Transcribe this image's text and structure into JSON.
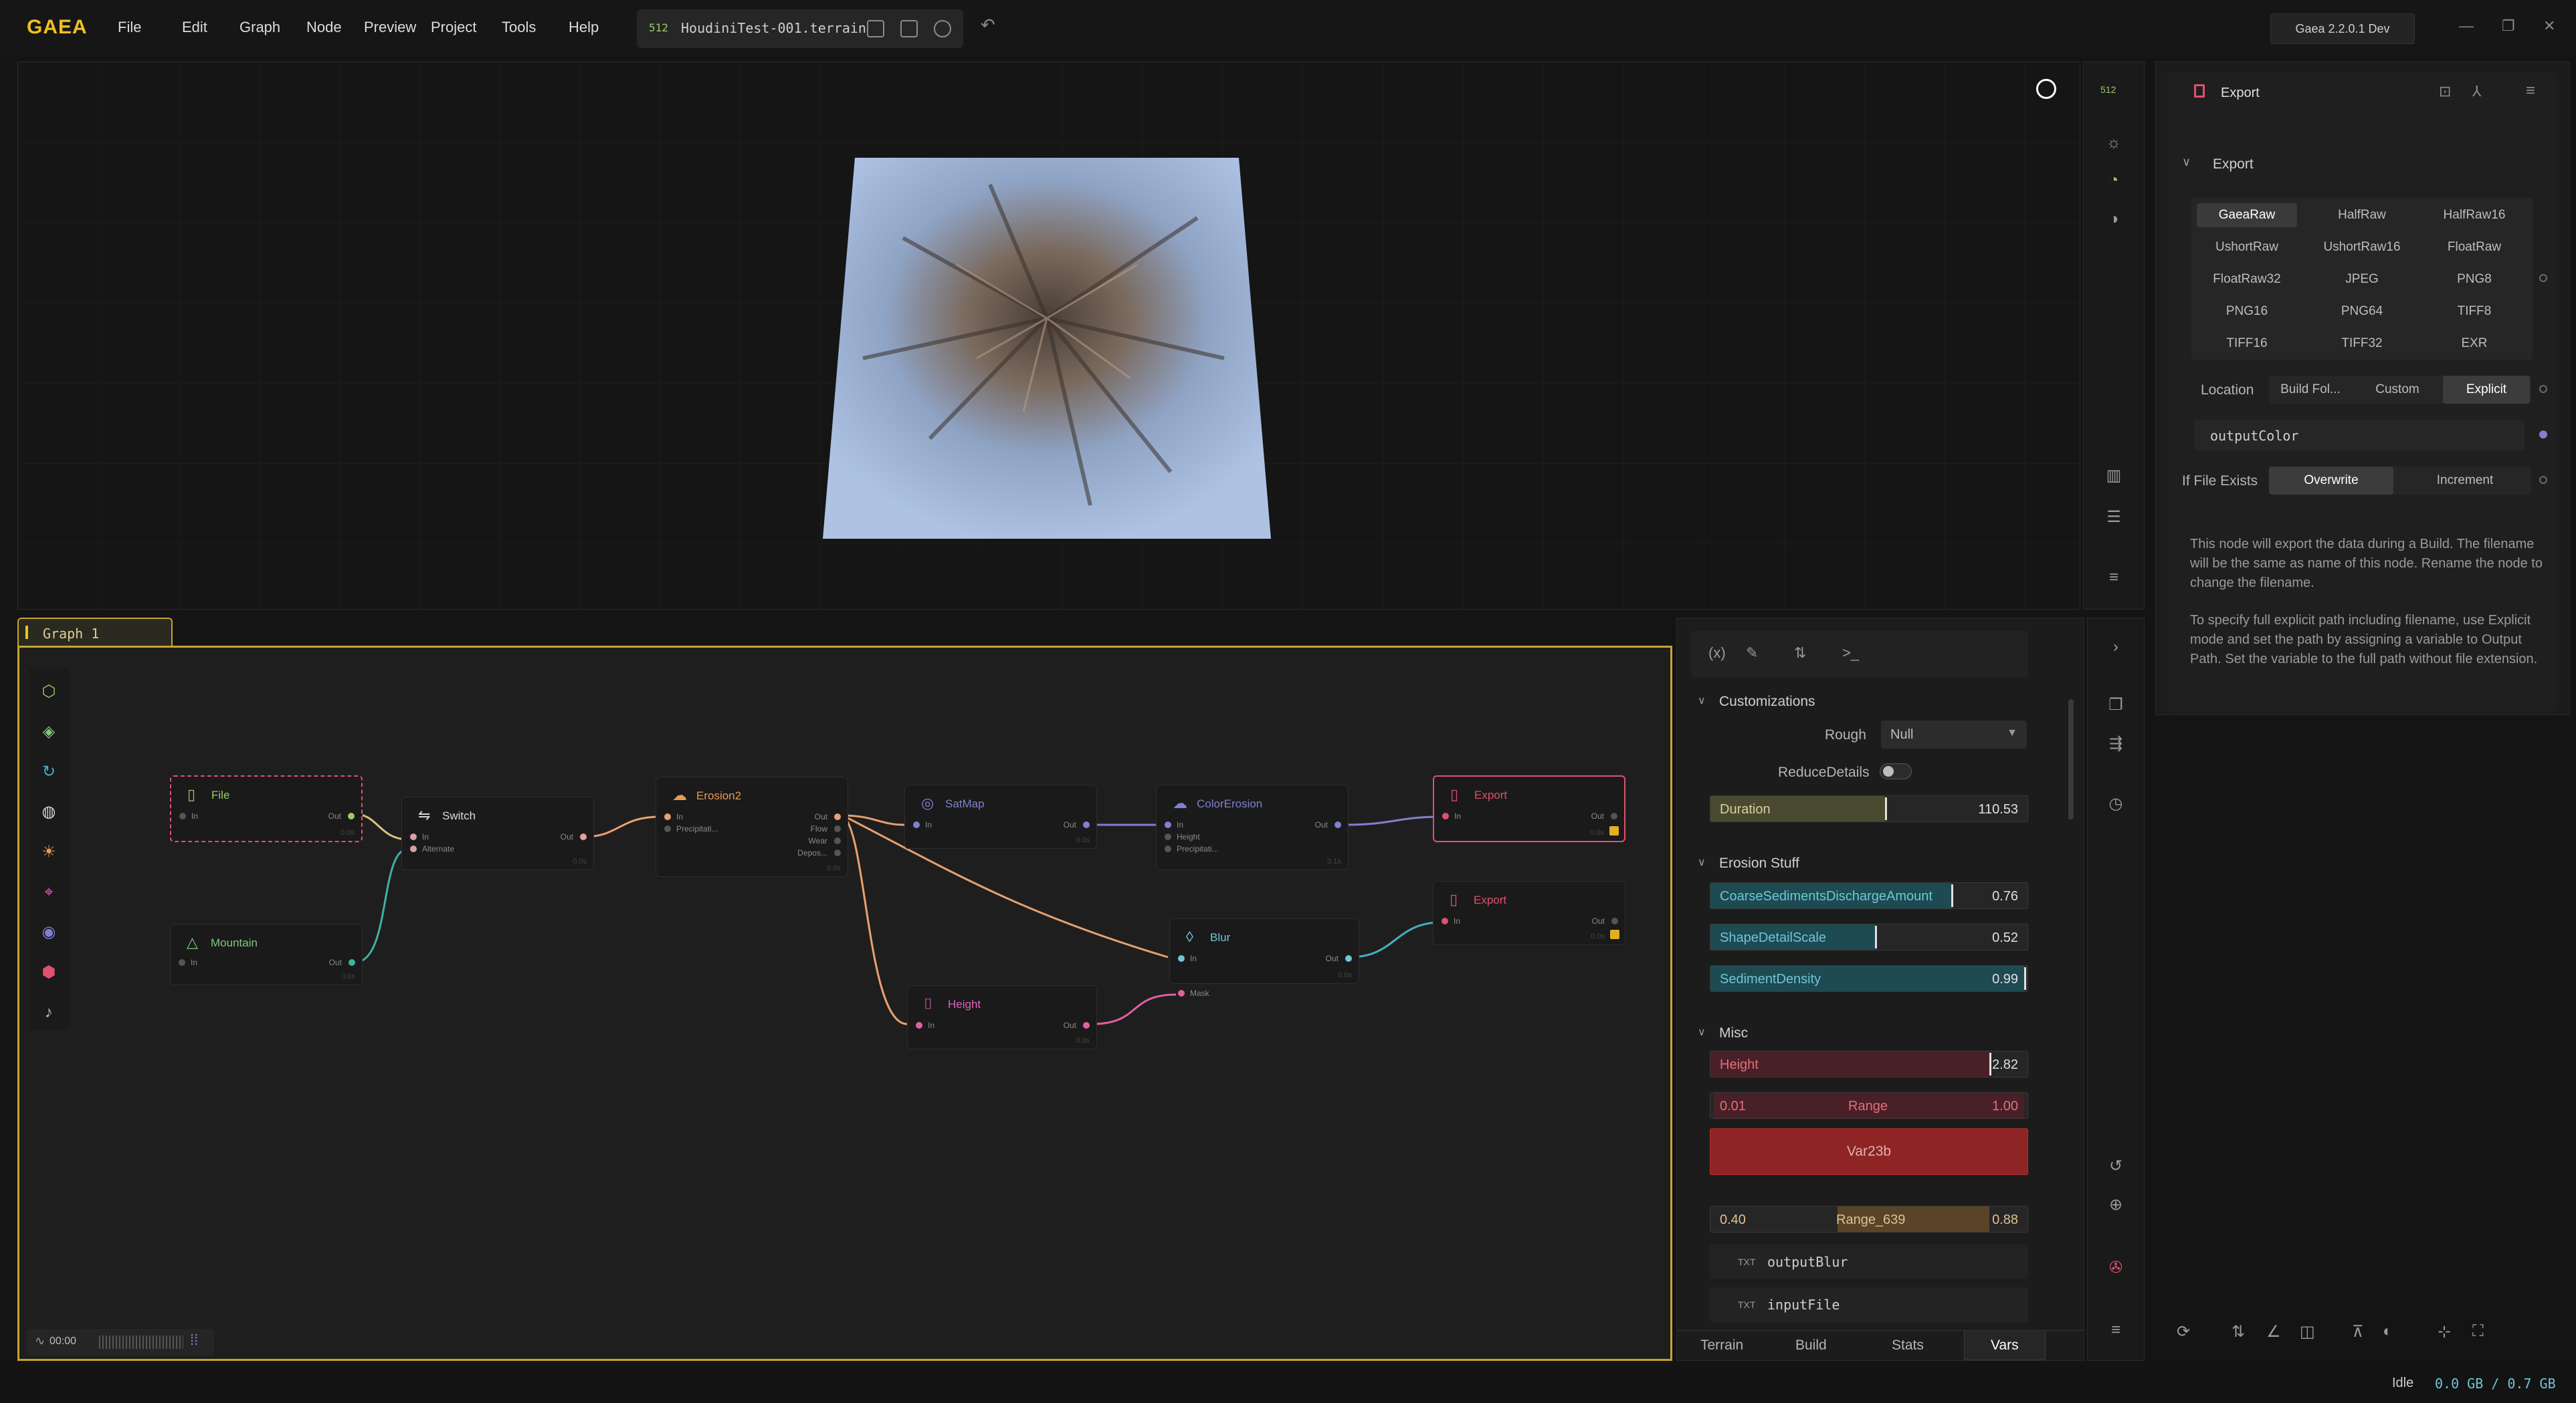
{
  "app": {
    "logo": "GAEA",
    "version": "Gaea 2.2.0.1 Dev"
  },
  "menu": [
    "File",
    "Edit",
    "Graph",
    "Node",
    "Preview",
    "Project",
    "Tools",
    "Help"
  ],
  "file_tab": {
    "resolution": "512",
    "filename": "HoudiniTest-001.terrain"
  },
  "viewport": {
    "resolution_badge": "512"
  },
  "graph": {
    "tab_label": "Graph 1",
    "timer": "00:00",
    "nodes": [
      {
        "id": "file",
        "title": "File",
        "color": "#9ccc65",
        "ports_in": [
          "In"
        ],
        "ports_out": [
          "Out"
        ],
        "time": "0.0s"
      },
      {
        "id": "mountain",
        "title": "Mountain",
        "color": "#7fc97f",
        "ports_in": [
          "In"
        ],
        "ports_out": [
          "Out"
        ],
        "time": "0.0s"
      },
      {
        "id": "switch",
        "title": "Switch",
        "color": "#d8d8d8",
        "ports_in": [
          "In",
          "Alternate"
        ],
        "ports_out": [
          "Out"
        ],
        "time": "0.0s"
      },
      {
        "id": "erosion2",
        "title": "Erosion2",
        "color": "#e89c50",
        "ports_in": [
          "In",
          "Precipitati..."
        ],
        "ports_out": [
          "Out",
          "Flow",
          "Wear",
          "Depos..."
        ],
        "time": "0.0s"
      },
      {
        "id": "satmap",
        "title": "SatMap",
        "color": "#8080d0",
        "ports_in": [
          "In"
        ],
        "ports_out": [
          "Out"
        ],
        "time": "0.0s"
      },
      {
        "id": "colorerosion",
        "title": "ColorErosion",
        "color": "#8080d0",
        "ports_in": [
          "In",
          "Height",
          "Precipitati..."
        ],
        "ports_out": [
          "Out"
        ],
        "time": "0.1s"
      },
      {
        "id": "height",
        "title": "Height",
        "color": "#e060c0",
        "ports_in": [
          "In"
        ],
        "ports_out": [
          "Out"
        ],
        "time": "0.0s"
      },
      {
        "id": "blur",
        "title": "Blur",
        "color": "#6ec6d8",
        "ports_in": [
          "In",
          "Mask"
        ],
        "ports_out": [
          "Out"
        ],
        "time": "0.0s"
      },
      {
        "id": "export1",
        "title": "Export",
        "color": "#e05070",
        "ports_in": [
          "In"
        ],
        "ports_out": [
          "Out"
        ],
        "time": "0.0s"
      },
      {
        "id": "export2",
        "title": "Export",
        "color": "#e05070",
        "ports_in": [
          "In"
        ],
        "ports_out": [
          "Out"
        ],
        "time": "0.0s"
      }
    ]
  },
  "vars": {
    "customizations": {
      "title": "Customizations",
      "rough_label": "Rough",
      "rough_value": "Null",
      "reduce_label": "ReduceDetails",
      "duration": {
        "label": "Duration",
        "value": "110.53",
        "fraction": 0.55
      }
    },
    "erosion_stuff": {
      "title": "Erosion Stuff",
      "items": [
        {
          "label": "CoarseSedimentsDischargeAmount",
          "value": "0.76",
          "fraction": 0.76
        },
        {
          "label": "ShapeDetailScale",
          "value": "0.52",
          "fraction": 0.52
        },
        {
          "label": "SedimentDensity",
          "value": "0.99",
          "fraction": 0.99
        }
      ]
    },
    "misc": {
      "title": "Misc",
      "height": {
        "label": "Height",
        "value": "2.82",
        "fraction": 0.88
      },
      "range": {
        "label": "Range",
        "min": "0.01",
        "max": "1.00"
      },
      "var_button": "Var23b",
      "range639": {
        "label": "Range_639",
        "min": "0.40",
        "max": "0.88"
      },
      "txt_tag": "TXT",
      "txt_items": [
        "outputBlur",
        "inputFile"
      ]
    },
    "tabs": [
      "Terrain",
      "Build",
      "Stats",
      "Vars"
    ]
  },
  "props": {
    "header_title": "Export",
    "section_title": "Export",
    "formats": [
      "GaeaRaw",
      "HalfRaw",
      "HalfRaw16",
      "UshortRaw",
      "UshortRaw16",
      "FloatRaw",
      "FloatRaw32",
      "JPEG",
      "PNG8",
      "PNG16",
      "PNG64",
      "TIFF8",
      "TIFF16",
      "TIFF32",
      "EXR"
    ],
    "selected_format": "GaeaRaw",
    "location_label": "Location",
    "location_options": [
      "Build Fol...",
      "Custom",
      "Explicit"
    ],
    "selected_location": "Explicit",
    "path_value": "outputColor",
    "if_exists_label": "If File Exists",
    "if_exists_options": [
      "Overwrite",
      "Increment"
    ],
    "selected_if_exists": "Overwrite",
    "description_1": "This node will export the data during a Build. The filename will be the same as name of this node. Rename the node to change the filename.",
    "description_2": "To specify full explicit path including filename, use Explicit mode and set the path by assigning a variable to Output Path. Set the variable to the full path without file extension."
  },
  "status": {
    "state": "Idle",
    "memory": "0.0 GB / 0.7 GB"
  },
  "colors": {
    "accent": "#f0c020",
    "cyan": "#3ab0c0",
    "danger": "#8e2424"
  }
}
